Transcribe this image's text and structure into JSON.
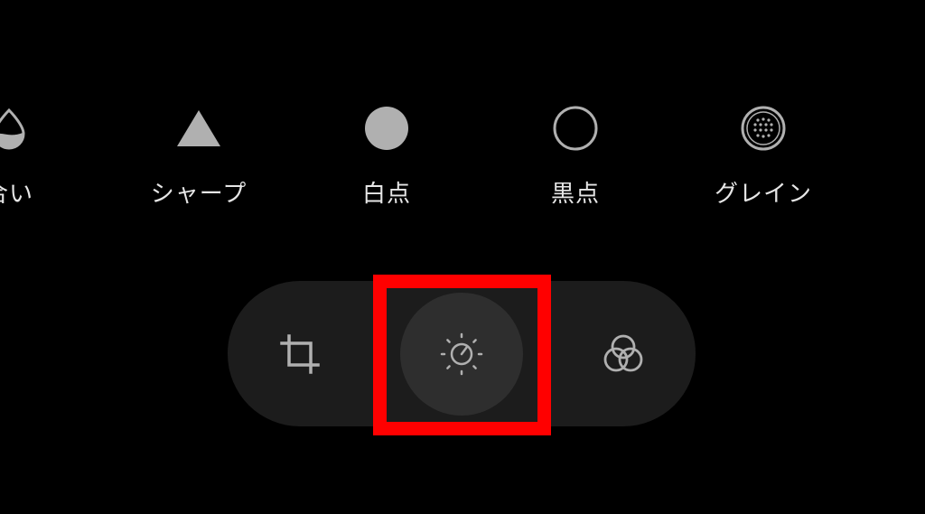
{
  "tools": {
    "items": [
      {
        "label": "合い",
        "icon": "water-drop-icon"
      },
      {
        "label": "シャープ",
        "icon": "triangle-icon"
      },
      {
        "label": "白点",
        "icon": "filled-circle-icon"
      },
      {
        "label": "黒点",
        "icon": "outline-circle-icon"
      },
      {
        "label": "グレイン",
        "icon": "grain-icon"
      }
    ]
  },
  "nav": {
    "items": [
      {
        "icon": "crop-icon",
        "active": false
      },
      {
        "icon": "adjust-icon",
        "active": true
      },
      {
        "icon": "filters-icon",
        "active": false
      }
    ]
  },
  "colors": {
    "background": "#000000",
    "icon_fill": "#b0b0b0",
    "label": "#e6e6e6",
    "pill": "#1c1c1c",
    "active_circle": "#2e2e2e",
    "highlight": "#ff0000"
  }
}
